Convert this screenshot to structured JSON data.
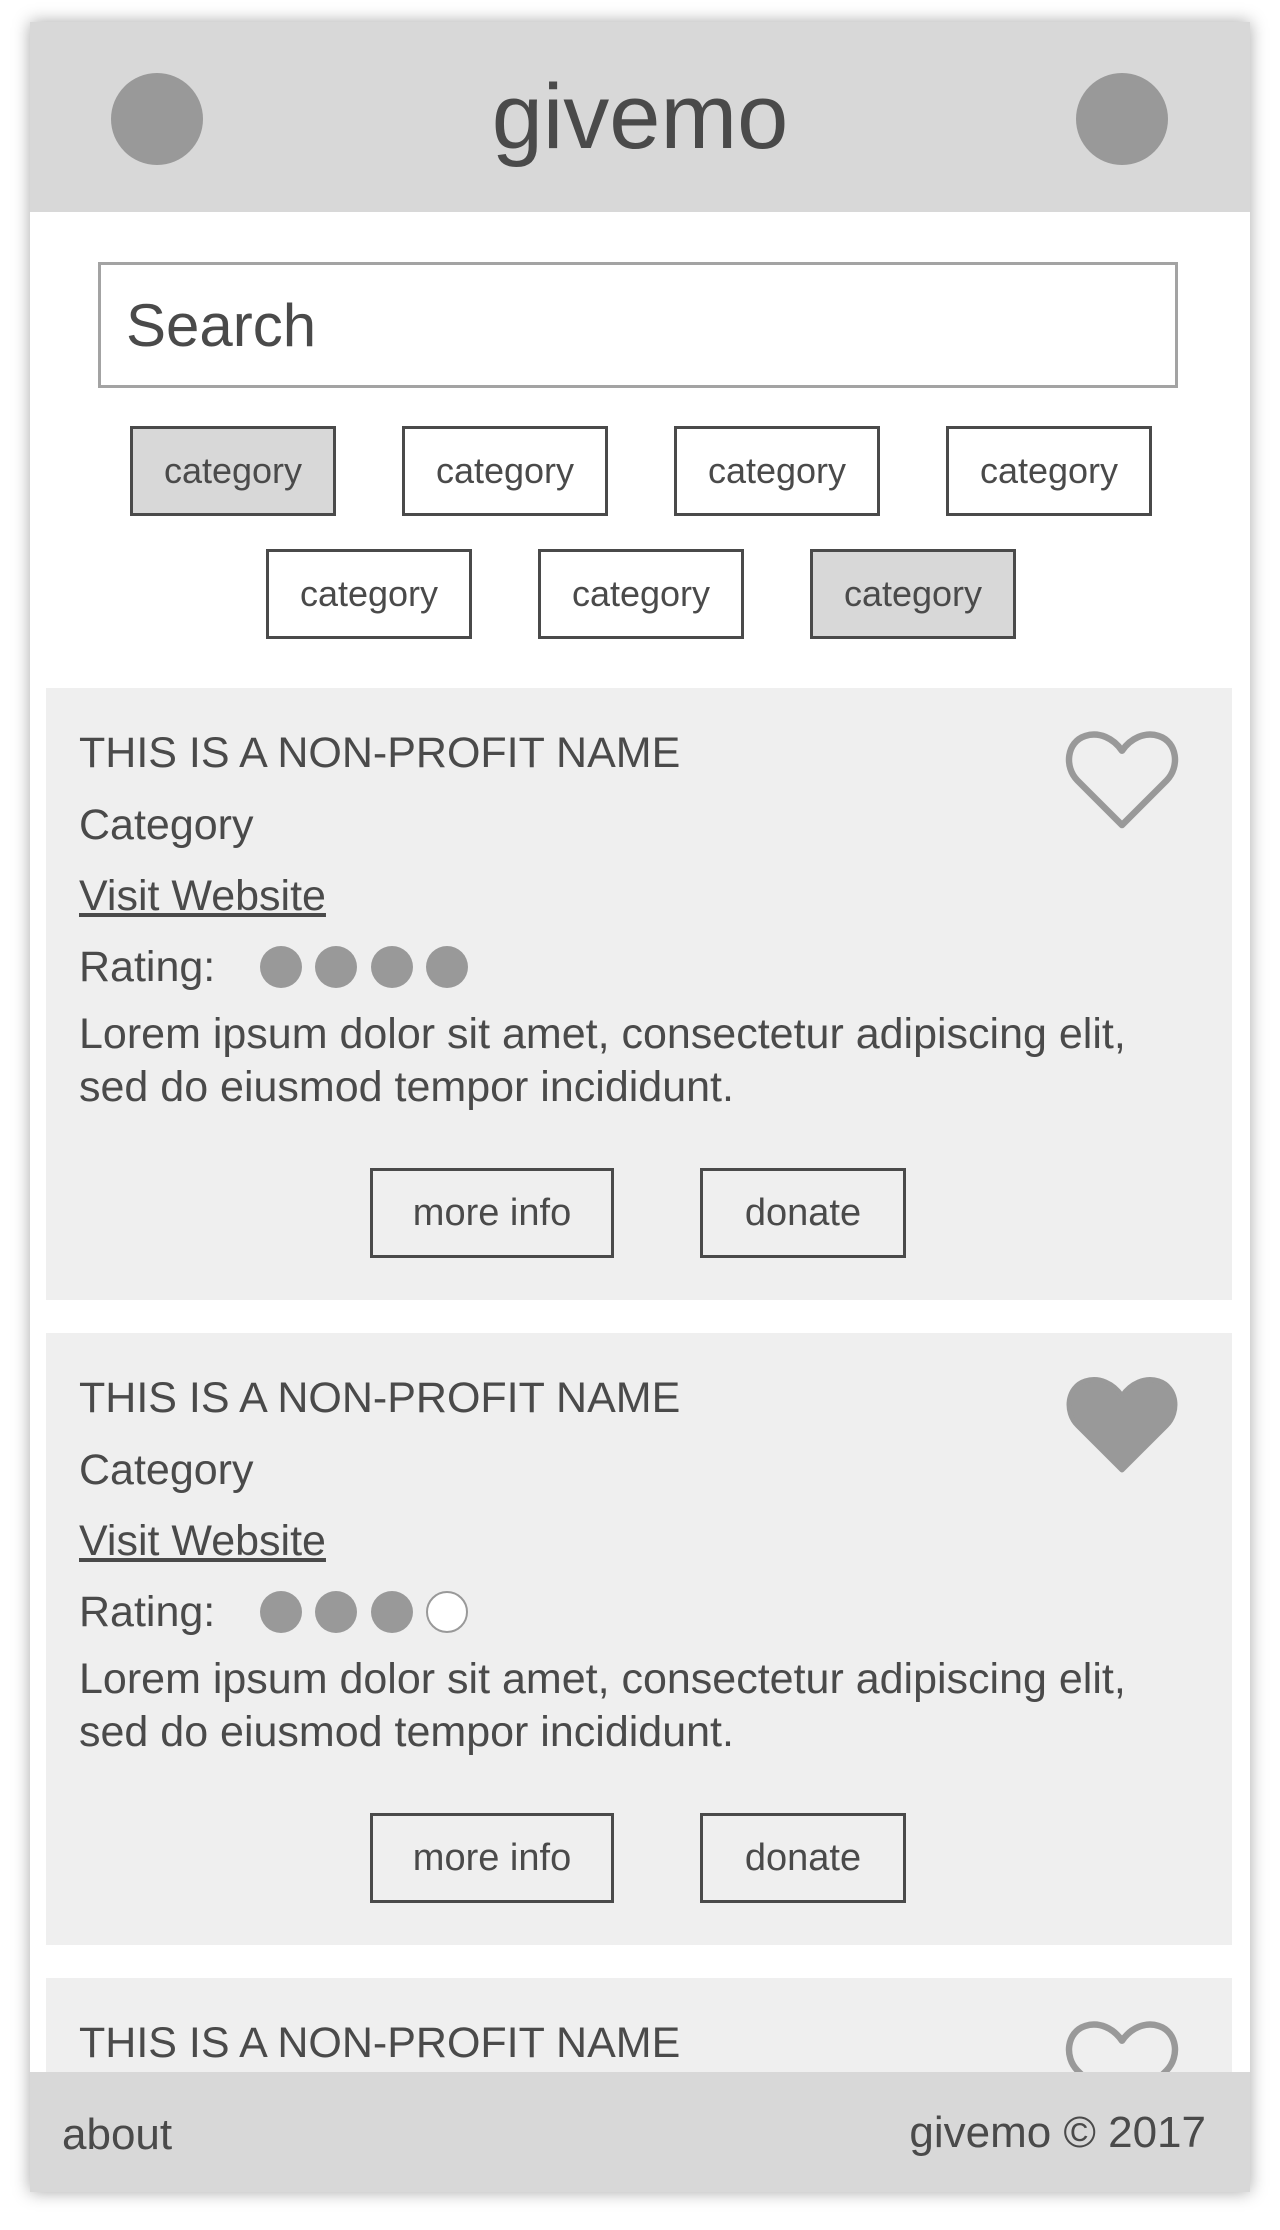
{
  "header": {
    "title": "givemo",
    "left_icon": "circle-icon",
    "right_icon": "circle-icon"
  },
  "search": {
    "placeholder": "Search"
  },
  "categories": [
    {
      "label": "category",
      "selected": true
    },
    {
      "label": "category",
      "selected": false
    },
    {
      "label": "category",
      "selected": false
    },
    {
      "label": "category",
      "selected": false
    },
    {
      "label": "category",
      "selected": false
    },
    {
      "label": "category",
      "selected": false
    },
    {
      "label": "category",
      "selected": true
    }
  ],
  "cards": [
    {
      "name": "THIS IS A NON-PROFIT NAME",
      "category": "Category",
      "website_label": "Visit Website",
      "rating_label": "Rating:",
      "rating": 4,
      "rating_max": 4,
      "description": "Lorem ipsum dolor sit amet, consectetur adipiscing elit, sed do eiusmod tempor incididunt.",
      "more_info_label": "more info",
      "donate_label": "donate",
      "favorited": false,
      "heart_icon": "heart-outline-icon"
    },
    {
      "name": "THIS IS A NON-PROFIT NAME",
      "category": "Category",
      "website_label": "Visit Website",
      "rating_label": "Rating:",
      "rating": 3,
      "rating_max": 4,
      "description": "Lorem ipsum dolor sit amet, consectetur adipiscing elit, sed do eiusmod tempor incididunt.",
      "more_info_label": "more info",
      "donate_label": "donate",
      "favorited": true,
      "heart_icon": "heart-filled-icon"
    },
    {
      "name": "THIS IS A NON-PROFIT NAME",
      "favorited": false,
      "heart_icon": "heart-outline-icon"
    }
  ],
  "footer": {
    "about_label": "about",
    "copyright": "givemo © 2017"
  },
  "colors": {
    "header_bg": "#d8d8d8",
    "card_bg": "#efefef",
    "accent": "#999999",
    "text": "#4a4a4a"
  }
}
